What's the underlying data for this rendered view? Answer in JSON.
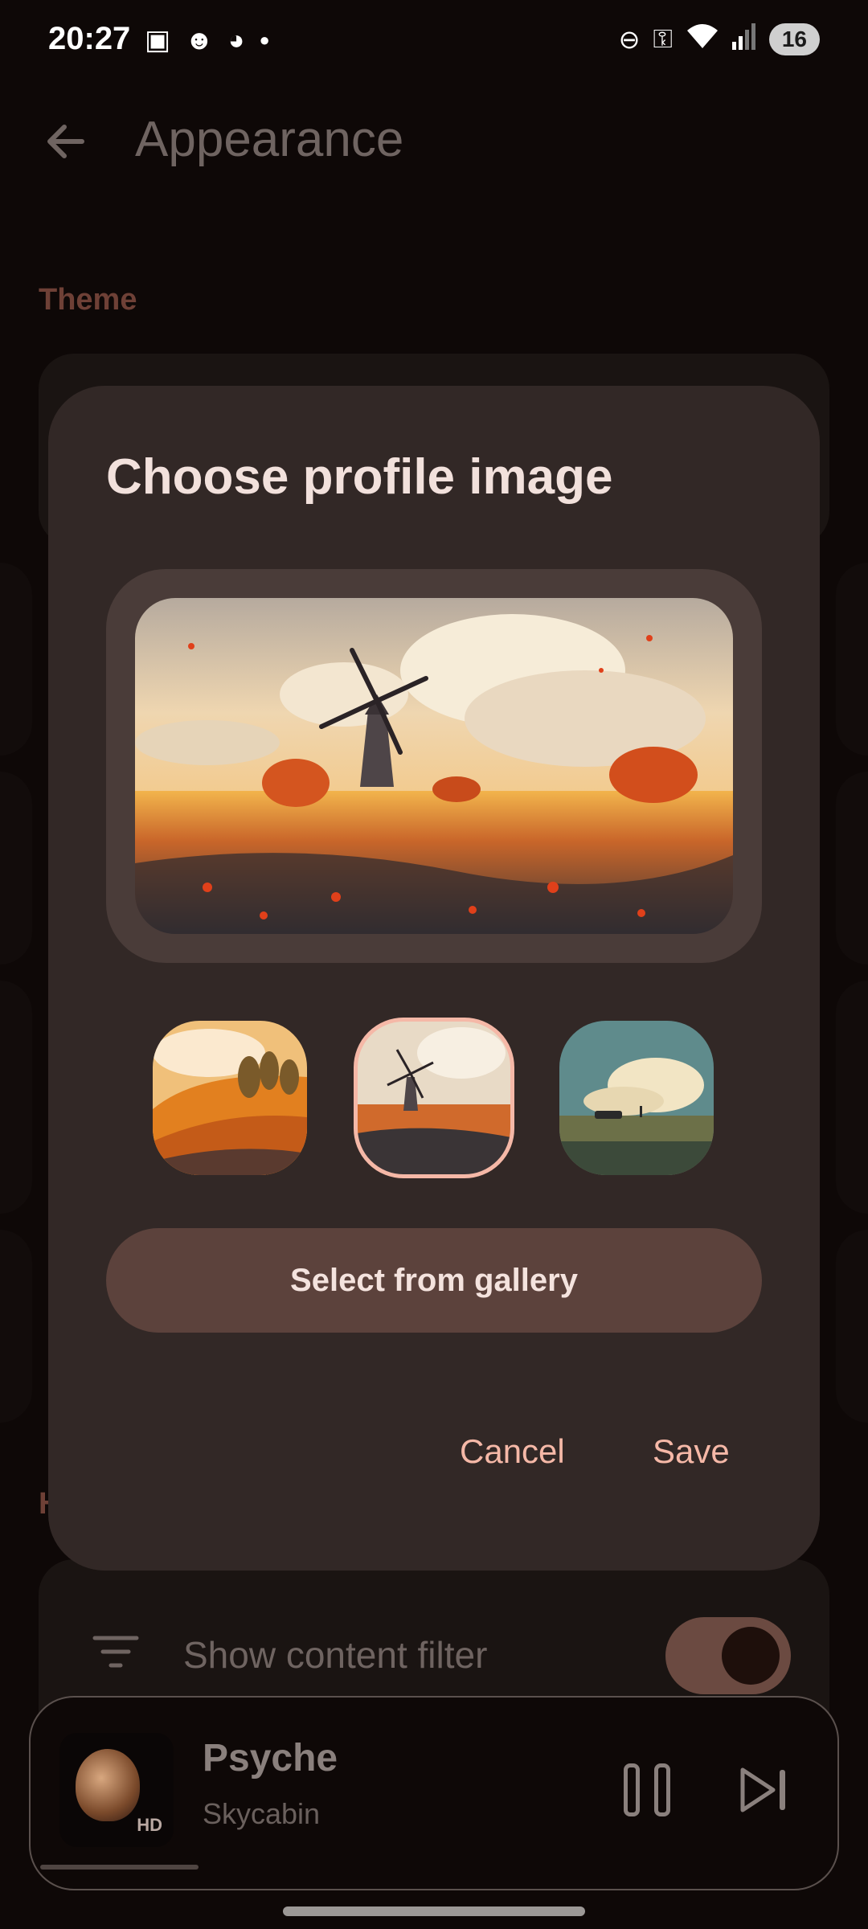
{
  "status_bar": {
    "time": "20:27",
    "battery_level": "16",
    "left_icons": [
      "screenshot-icon",
      "reddit-icon",
      "cat-app-icon",
      "dot-icon"
    ],
    "right_icons": [
      "dnd-icon",
      "vpn-key-icon",
      "wifi-icon",
      "signal-icon"
    ]
  },
  "app_bar": {
    "title": "Appearance"
  },
  "sections": {
    "theme_header": "Theme",
    "second_header_visible_letter": "H"
  },
  "content_filter": {
    "label": "Show content filter",
    "enabled": true
  },
  "dialog": {
    "title": "Choose profile image",
    "preview": "windmill-field-image",
    "thumbnails": [
      {
        "name": "golden-hills-image",
        "selected": false
      },
      {
        "name": "windmill-field-image",
        "selected": true
      },
      {
        "name": "car-in-meadow-image",
        "selected": false
      }
    ],
    "gallery_button": "Select from gallery",
    "cancel_label": "Cancel",
    "save_label": "Save"
  },
  "mini_player": {
    "title": "Psyche",
    "artist": "Skycabin",
    "badge": "HD",
    "progress": 0.2
  }
}
